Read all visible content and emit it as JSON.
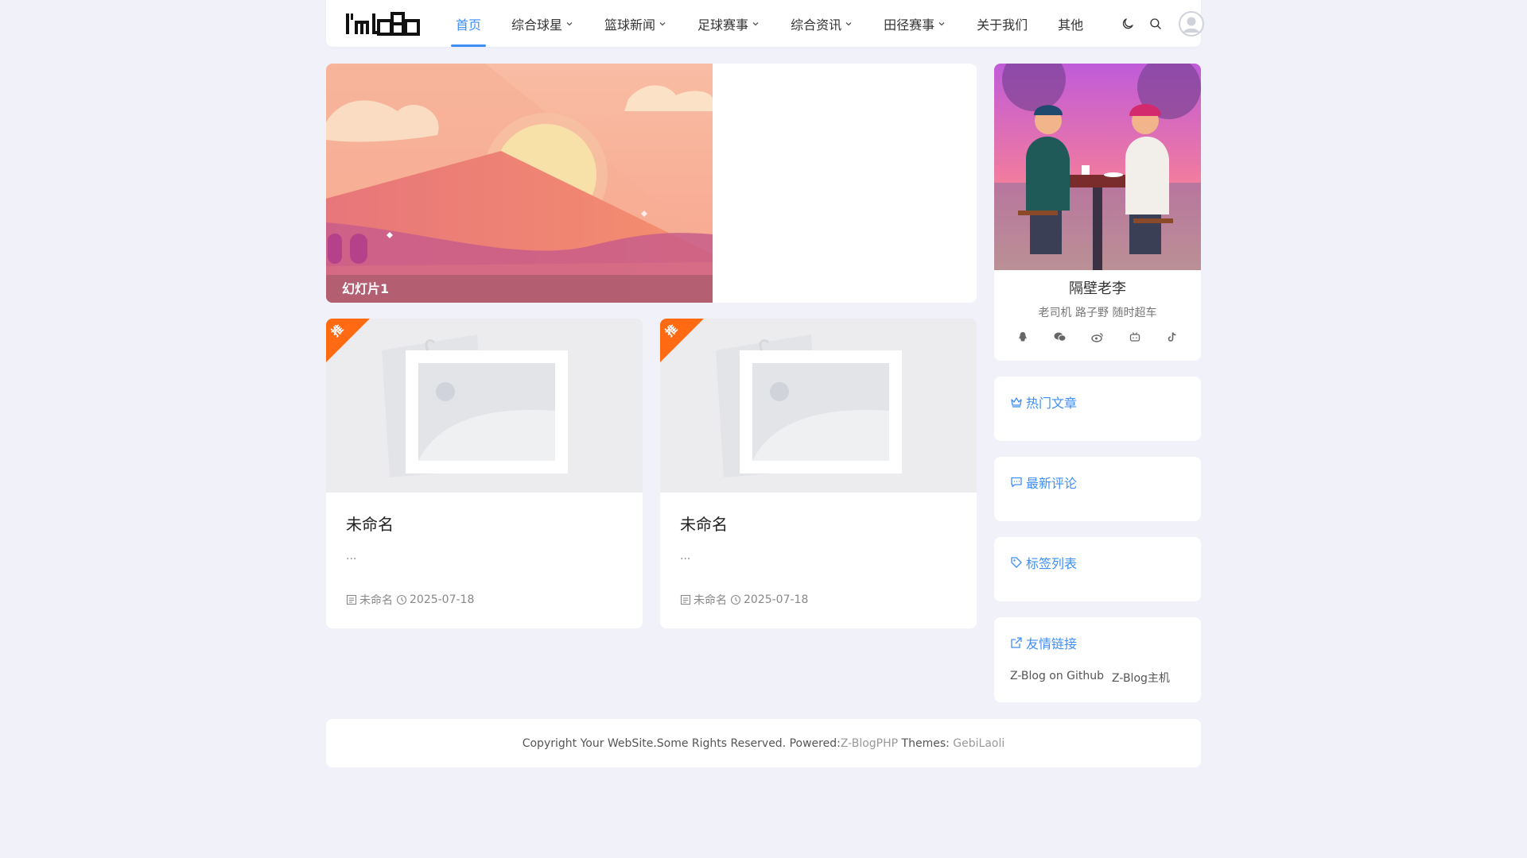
{
  "header": {
    "logo_text": "I'm logo",
    "nav": [
      {
        "label": "首页",
        "active": true,
        "dropdown": false
      },
      {
        "label": "综合球星",
        "active": false,
        "dropdown": true
      },
      {
        "label": "篮球新闻",
        "active": false,
        "dropdown": true
      },
      {
        "label": "足球赛事",
        "active": false,
        "dropdown": true
      },
      {
        "label": "综合资讯",
        "active": false,
        "dropdown": true
      },
      {
        "label": "田径赛事",
        "active": false,
        "dropdown": true
      },
      {
        "label": "关于我们",
        "active": false,
        "dropdown": false
      },
      {
        "label": "其他",
        "active": false,
        "dropdown": false
      }
    ],
    "tools": [
      "moon-icon",
      "search-icon",
      "user-avatar"
    ]
  },
  "slider": {
    "caption": "幻灯片1"
  },
  "posts": [
    {
      "badge": "推",
      "title": "未命名",
      "excerpt": "...",
      "category": "未命名",
      "date": "2025-07-18"
    },
    {
      "badge": "推",
      "title": "未命名",
      "excerpt": "...",
      "category": "未命名",
      "date": "2025-07-18"
    }
  ],
  "profile": {
    "name": "隔壁老李",
    "desc": "老司机 路子野 随时超车",
    "social": [
      "qq-icon",
      "wechat-icon",
      "weibo-icon",
      "bilibili-icon",
      "tiktok-icon"
    ]
  },
  "widgets": {
    "hot": "热门文章",
    "comments": "最新评论",
    "tags": "标签列表",
    "links": "友情链接",
    "link_items": [
      "Z-Blog on Github",
      "Z-Blog主机"
    ]
  },
  "footer": {
    "text": "Copyright Your WebSite.Some Rights Reserved. Powered: ",
    "powered": "Z-BlogPHP",
    "themes_label": " Themes: ",
    "theme": "GebiLaoli"
  },
  "colors": {
    "accent": "#3e8ef7",
    "ribbon": "#ff6a13",
    "background": "#f0f1f9"
  }
}
